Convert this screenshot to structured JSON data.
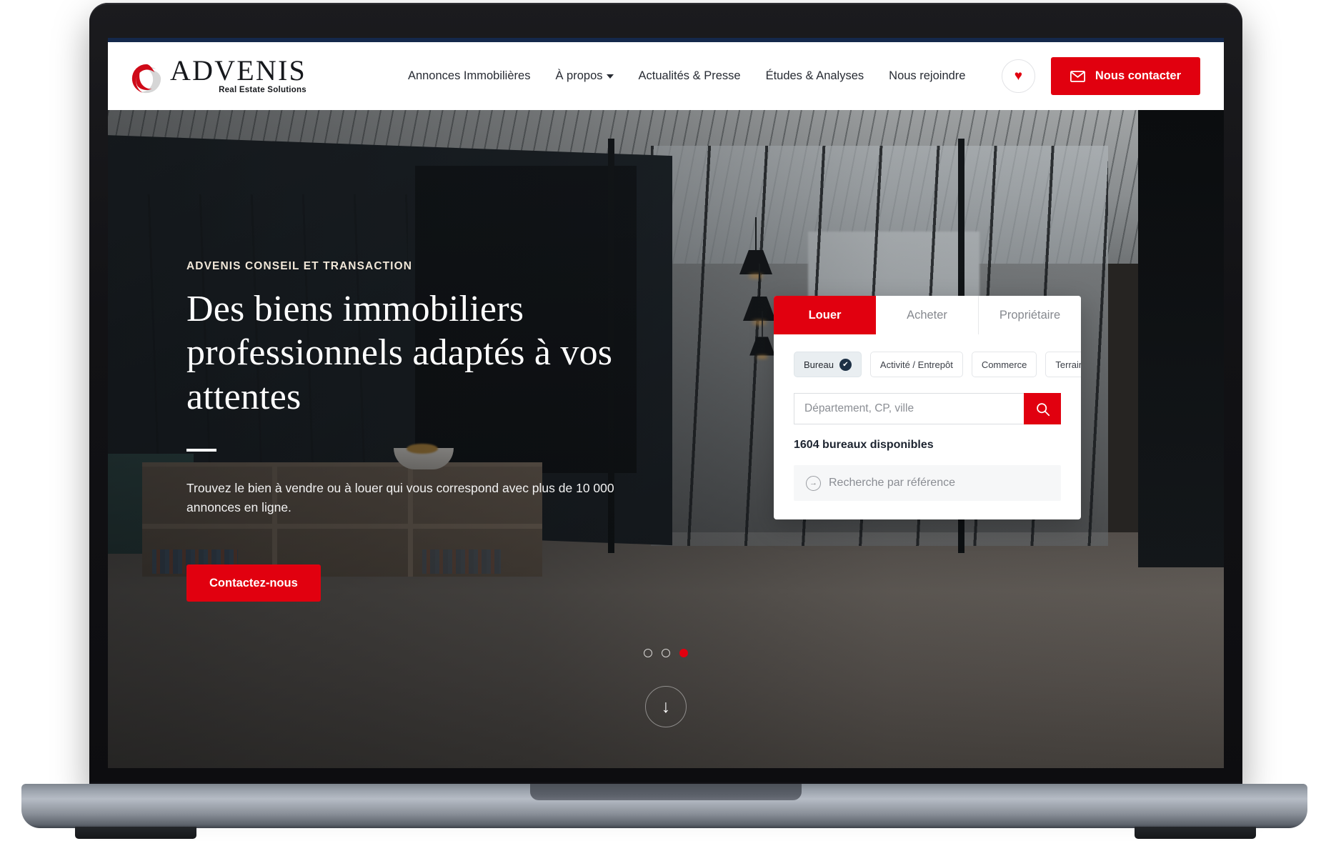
{
  "brand": {
    "wordmark": "ADVENIS",
    "tagline": "Real Estate Solutions",
    "logo_icon": "advenis-swirl-icon",
    "accent_color": "#e1000f",
    "topbar_color": "#14284b"
  },
  "nav": {
    "items": [
      {
        "label": "Annonces Immobilières",
        "has_dropdown": false
      },
      {
        "label": "À propos",
        "has_dropdown": true
      },
      {
        "label": "Actualités & Presse",
        "has_dropdown": false
      },
      {
        "label": "Études & Analyses",
        "has_dropdown": false
      },
      {
        "label": "Nous rejoindre",
        "has_dropdown": false
      }
    ]
  },
  "header_actions": {
    "favorites_icon": "heart-icon",
    "favorites_glyph": "♥",
    "contact_label": "Nous contacter",
    "contact_icon": "envelope-icon"
  },
  "hero": {
    "eyebrow": "ADVENIS CONSEIL ET TRANSACTION",
    "title": "Des biens immobiliers professionnels adaptés à vos attentes",
    "subtitle": "Trouvez le bien à vendre ou à louer qui vous correspond avec plus de 10 000 annonces en ligne.",
    "cta_label": "Contactez-nous",
    "scroll_icon": "arrow-down-icon",
    "scroll_glyph": "↓"
  },
  "search_widget": {
    "tabs": [
      {
        "label": "Louer",
        "active": true
      },
      {
        "label": "Acheter",
        "active": false
      },
      {
        "label": "Propriétaire",
        "active": false
      }
    ],
    "categories": [
      {
        "label": "Bureau",
        "selected": true,
        "check_glyph": "✔"
      },
      {
        "label": "Activité / Entrepôt",
        "selected": false
      },
      {
        "label": "Commerce",
        "selected": false
      },
      {
        "label": "Terrain",
        "selected": false
      }
    ],
    "location_placeholder": "Département, CP, ville",
    "location_value": "",
    "search_icon": "search-icon",
    "results_count": "1604 bureaux disponibles",
    "reference_label": "Recherche par référence",
    "reference_icon": "arrow-right-circle-icon",
    "reference_glyph": "→"
  },
  "carousel": {
    "slides": [
      {
        "active": false
      },
      {
        "active": false
      },
      {
        "active": true
      }
    ]
  }
}
